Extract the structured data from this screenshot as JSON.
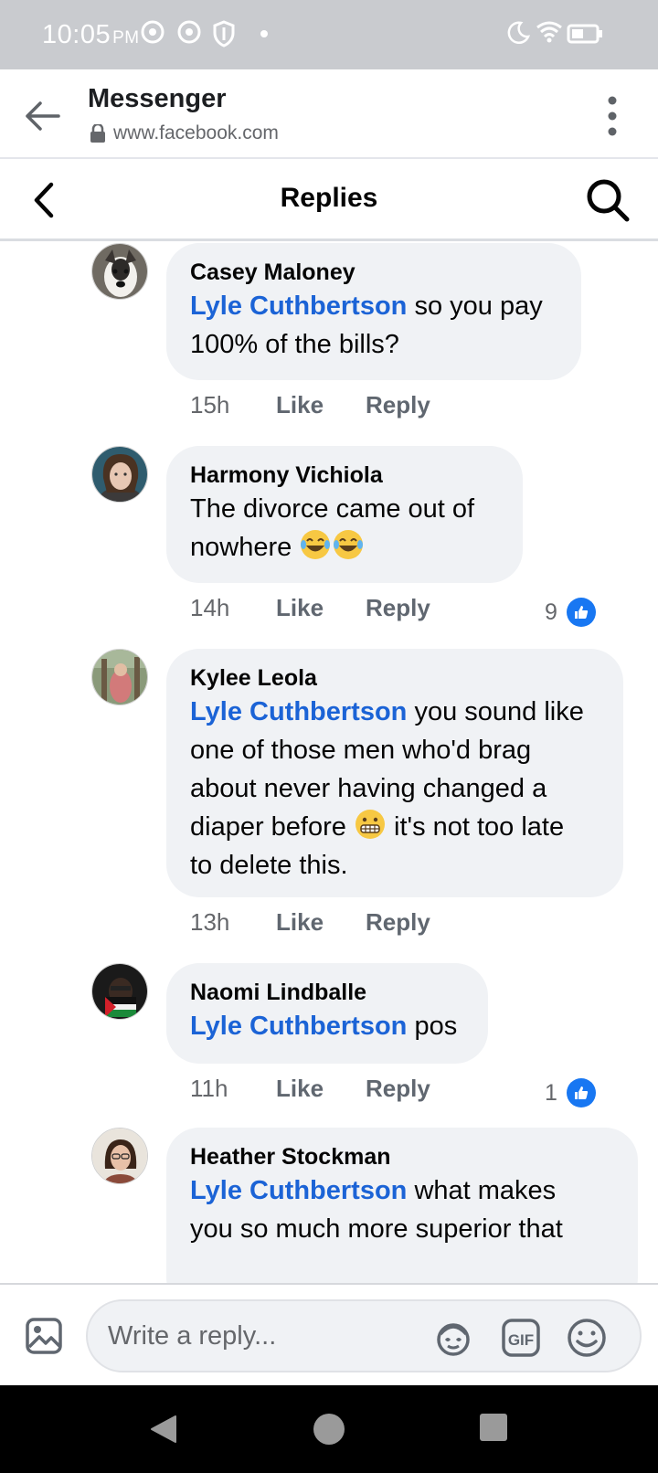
{
  "status_bar": {
    "time": "10:05",
    "ampm": "PM"
  },
  "browser": {
    "title": "Messenger",
    "url": "www.facebook.com"
  },
  "replies_header": {
    "title": "Replies"
  },
  "comments": [
    {
      "author": "Casey Maloney",
      "mention": "Lyle Cuthbertson",
      "text_lines": [
        " so you pay",
        "100% of the bills?"
      ],
      "time": "15h",
      "like": "Like",
      "reply": "Reply",
      "reaction_count": ""
    },
    {
      "author": "Harmony Vichiola",
      "mention": "",
      "text_lines": [
        "The divorce came out of",
        "nowhere "
      ],
      "time": "14h",
      "like": "Like",
      "reply": "Reply",
      "reaction_count": "9"
    },
    {
      "author": "Kylee Leola",
      "mention": "Lyle Cuthbertson",
      "text_lines": [
        " you sound like",
        "one of those men who'd brag",
        "about never having changed a",
        "diaper before ",
        " it's not too late",
        "to delete this."
      ],
      "time": "13h",
      "like": "Like",
      "reply": "Reply",
      "reaction_count": ""
    },
    {
      "author": "Naomi Lindballe",
      "mention": "Lyle Cuthbertson",
      "text_lines": [
        " pos"
      ],
      "time": "11h",
      "like": "Like",
      "reply": "Reply",
      "reaction_count": "1"
    },
    {
      "author": "Heather Stockman",
      "mention": "Lyle Cuthbertson",
      "text_lines": [
        " what makes",
        "you so much more superior that"
      ],
      "time": "",
      "like": "",
      "reply": "",
      "reaction_count": ""
    }
  ],
  "compose": {
    "placeholder": "Write a reply..."
  },
  "colors": {
    "mention": "#1b63d6",
    "bubble": "#f0f2f5",
    "like_blue": "#1877f2"
  },
  "icons": [
    "back-arrow-icon",
    "lock-icon",
    "more-vert-icon",
    "chevron-left-icon",
    "search-icon",
    "photo-icon",
    "avatar-sticker-icon",
    "gif-icon",
    "smiley-icon",
    "nav-back-icon",
    "nav-home-icon",
    "nav-recents-icon"
  ]
}
